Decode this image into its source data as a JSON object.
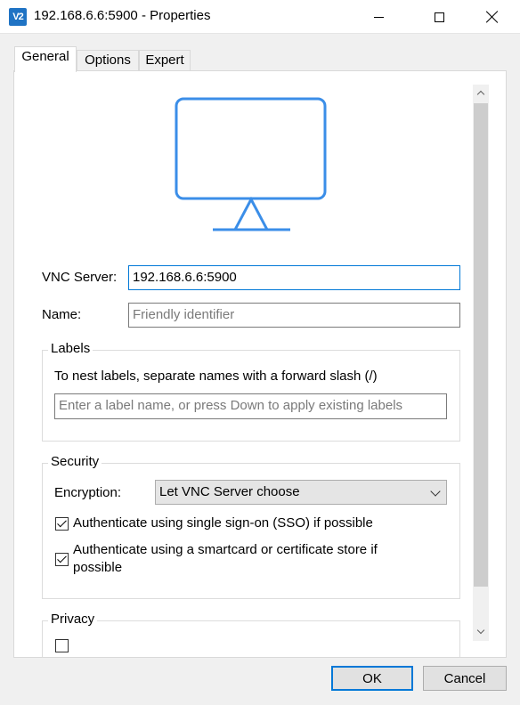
{
  "window": {
    "app_icon_text": "V2",
    "title": "192.168.6.6:5900 - Properties"
  },
  "tabs": [
    {
      "label": "General"
    },
    {
      "label": "Options"
    },
    {
      "label": "Expert"
    }
  ],
  "general": {
    "vnc_server_label": "VNC Server:",
    "vnc_server_value": "192.168.6.6:5900",
    "name_label": "Name:",
    "name_placeholder": "Friendly identifier",
    "labels": {
      "title": "Labels",
      "hint": "To nest labels, separate names with a forward slash (/)",
      "input_placeholder": "Enter a label name, or press Down to apply existing labels"
    },
    "security": {
      "title": "Security",
      "encryption_label": "Encryption:",
      "encryption_value": "Let VNC Server choose",
      "sso_label": "Authenticate using single sign-on (SSO) if possible",
      "sso_checked": true,
      "smartcard_label_line1": "Authenticate using a smartcard or certificate store if",
      "smartcard_label_line2": "possible",
      "smartcard_checked": true
    },
    "privacy": {
      "title": "Privacy"
    }
  },
  "buttons": {
    "ok": "OK",
    "cancel": "Cancel"
  },
  "colors": {
    "accent": "#0078d7",
    "monitor_icon": "#3b8ee8",
    "app_icon": "#1f73c4"
  },
  "icons": {
    "app": "vnc-viewer-icon",
    "monitor": "monitor-icon"
  }
}
